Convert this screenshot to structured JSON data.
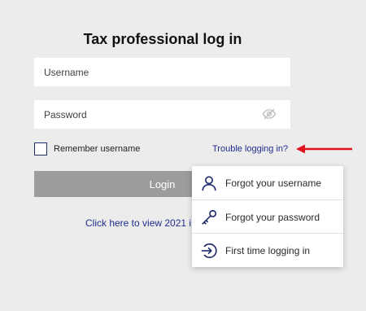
{
  "title": "Tax professional log in",
  "username": {
    "placeholder": "Username",
    "value": ""
  },
  "password": {
    "placeholder": "Password",
    "value": ""
  },
  "password_toggle_icon": "eye-slash-icon",
  "remember": {
    "label": "Remember username",
    "checked": false
  },
  "trouble_link": "Trouble logging in?",
  "login_button": "Login",
  "view_link": "Click here to view 2021 i",
  "dropdown": {
    "items": [
      {
        "label": "Forgot your username",
        "icon": "person-icon"
      },
      {
        "label": "Forgot your password",
        "icon": "key-icon"
      },
      {
        "label": "First time logging in",
        "icon": "sign-in-icon"
      }
    ]
  },
  "colors": {
    "background": "#ececec",
    "link": "#1f2d8e",
    "button": "#9c9c9c",
    "annotation_arrow": "#e0141e",
    "icon": "#1f2d6e"
  }
}
